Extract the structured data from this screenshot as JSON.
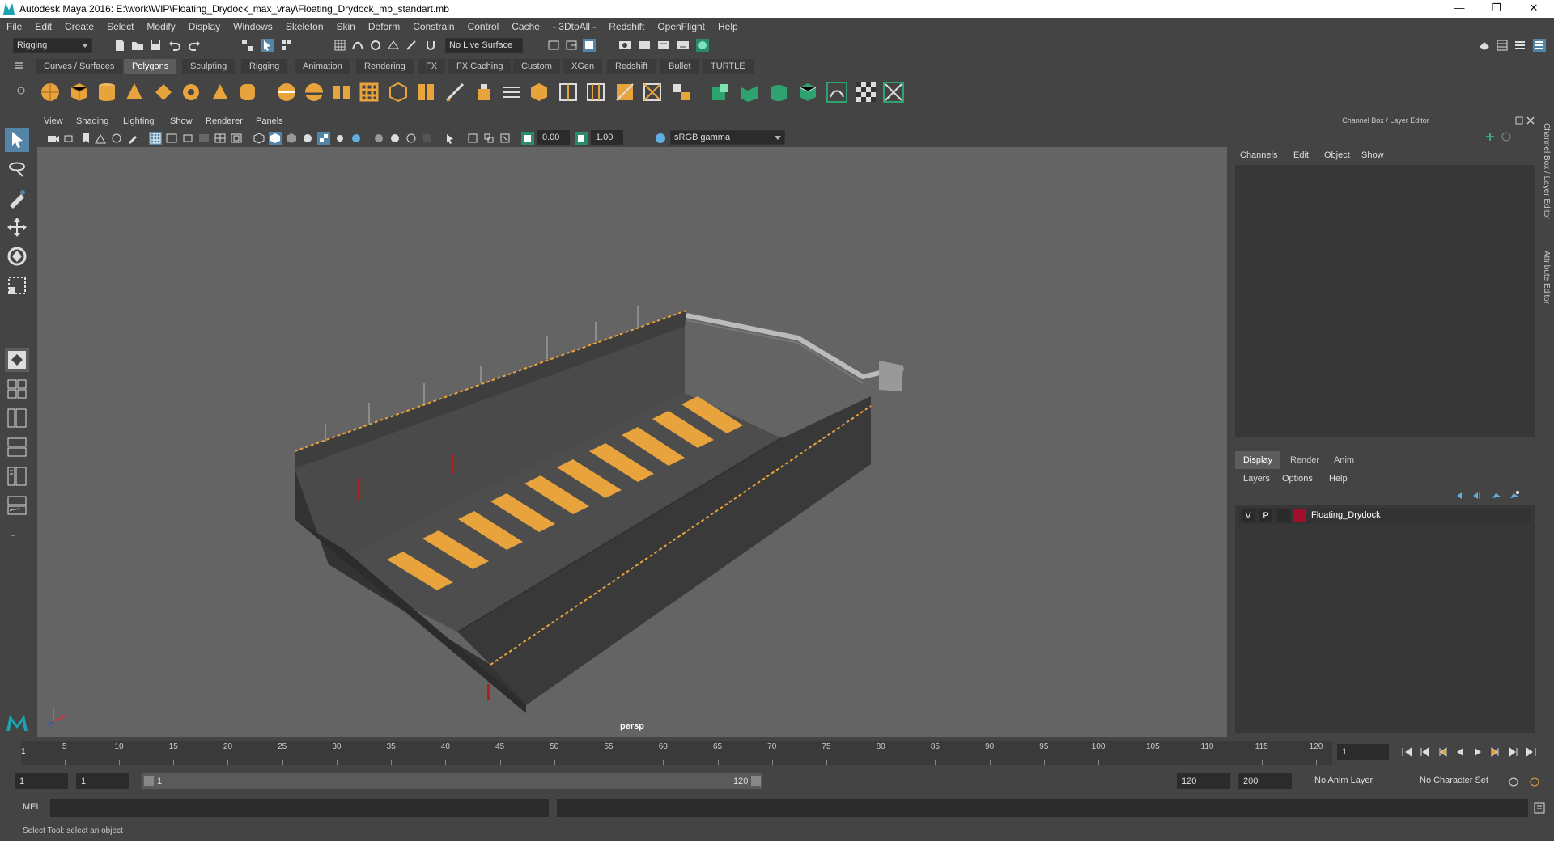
{
  "window": {
    "title": "Autodesk Maya 2016: E:\\work\\WIP\\Floating_Drydock_max_vray\\Floating_Drydock_mb_standart.mb",
    "minimize": "—",
    "restore": "❐",
    "close": "✕"
  },
  "menubar": [
    "File",
    "Edit",
    "Create",
    "Select",
    "Modify",
    "Display",
    "Windows",
    "Skeleton",
    "Skin",
    "Deform",
    "Constrain",
    "Control",
    "Cache",
    "- 3DtoAll -",
    "Redshift",
    "OpenFlight",
    "Help"
  ],
  "statusline": {
    "mode": "Rigging",
    "live_surface": "No Live Surface"
  },
  "shelf_tabs": [
    "Curves / Surfaces",
    "Polygons",
    "Sculpting",
    "Rigging",
    "Animation",
    "Rendering",
    "FX",
    "FX Caching",
    "Custom",
    "XGen",
    "Redshift",
    "Bullet",
    "TURTLE"
  ],
  "shelf_active": "Polygons",
  "viewport": {
    "menus": [
      "View",
      "Shading",
      "Lighting",
      "Show",
      "Renderer",
      "Panels"
    ],
    "exposure": "0.00",
    "gamma": "1.00",
    "color_space": "sRGB gamma",
    "camera_label": "persp"
  },
  "right_panel": {
    "title": "Channel Box / Layer Editor",
    "menus": [
      "Channels",
      "Edit",
      "Object",
      "Show"
    ],
    "tabs": [
      "Display",
      "Render",
      "Anim"
    ],
    "active_tab": "Display",
    "layer_menus": [
      "Layers",
      "Options",
      "Help"
    ],
    "layers": [
      {
        "visible": "V",
        "playback": "P",
        "color": "#a0102a",
        "name": "Floating_Drydock"
      }
    ],
    "side_tabs": [
      "Channel Box / Layer Editor",
      "Attribute Editor"
    ]
  },
  "timeline": {
    "ticks": [
      5,
      10,
      15,
      20,
      25,
      30,
      35,
      40,
      45,
      50,
      55,
      60,
      65,
      70,
      75,
      80,
      85,
      90,
      95,
      100,
      105,
      110,
      115,
      120
    ],
    "start_label": "1",
    "current_frame": "1"
  },
  "range": {
    "start": "1",
    "playback_start": "1",
    "slider_start": "1",
    "slider_end": "120",
    "playback_end": "120",
    "end": "200",
    "anim_layer": "No Anim Layer",
    "character_set": "No Character Set"
  },
  "command": {
    "label": "MEL"
  },
  "help_text": "Select Tool: select an object",
  "colors": {
    "accent_orange": "#e8a33c",
    "accent_teal": "#1aa3b0",
    "layer_red": "#a0102a"
  }
}
